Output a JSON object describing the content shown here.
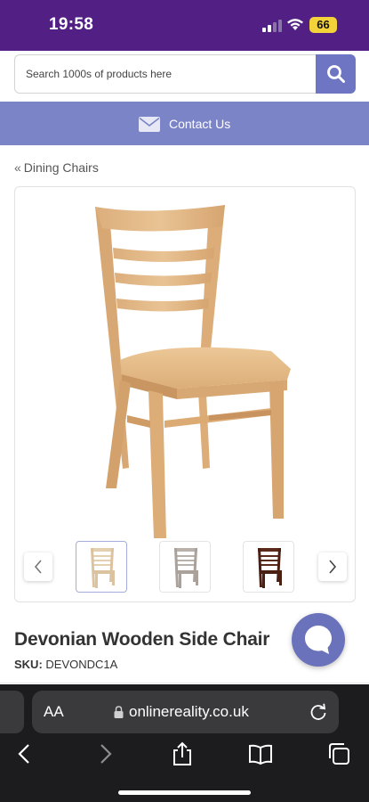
{
  "status_bar": {
    "time": "19:58",
    "battery": "66"
  },
  "search": {
    "placeholder": "Search 1000s of products here"
  },
  "contact": {
    "label": "Contact Us"
  },
  "breadcrumb": {
    "arrow": "«",
    "label": "Dining Chairs"
  },
  "product": {
    "title": "Devonian Wooden Side Chair",
    "sku_label": "SKU:",
    "sku_value": "DEVONDC1A"
  },
  "gallery": {
    "thumbnails": [
      {
        "finish": "natural",
        "color": "#e4cfb0"
      },
      {
        "finish": "grey",
        "color": "#b9b2ab"
      },
      {
        "finish": "walnut",
        "color": "#5a2a1a"
      }
    ],
    "selected_index": 0
  },
  "safari": {
    "aa_label": "AA",
    "domain": "onlinereality.co.uk"
  },
  "colors": {
    "header_purple": "#521f85",
    "contact_bar": "#7c84c8",
    "search_button": "#6e75c2",
    "chat_bubble": "#6b72bc",
    "battery": "#f4d33a"
  },
  "icons": [
    "search-icon",
    "mail-icon",
    "chevron-left-icon",
    "chevron-right-icon",
    "chat-icon",
    "lock-icon",
    "reload-icon",
    "back-icon",
    "forward-icon",
    "share-icon",
    "bookmarks-icon",
    "tabs-icon"
  ]
}
